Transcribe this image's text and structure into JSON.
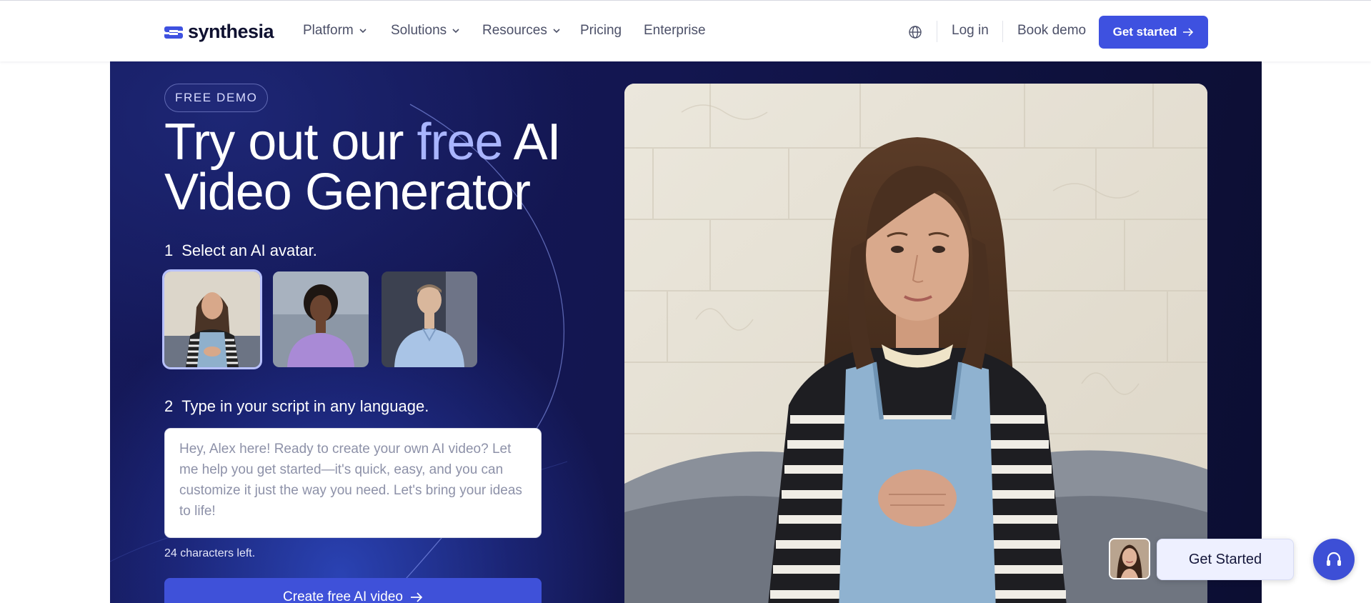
{
  "nav": {
    "logo_text": "synthesia",
    "items": [
      {
        "label": "Platform",
        "has_dropdown": true
      },
      {
        "label": "Solutions",
        "has_dropdown": true
      },
      {
        "label": "Resources",
        "has_dropdown": true
      },
      {
        "label": "Pricing",
        "has_dropdown": false
      },
      {
        "label": "Enterprise",
        "has_dropdown": false
      }
    ],
    "language_icon": "globe-icon",
    "login_label": "Log in",
    "book_demo_label": "Book demo",
    "get_started_label": "Get started"
  },
  "hero": {
    "badge": "FREE DEMO",
    "headline_part1": "Try out our ",
    "headline_accent": "free",
    "headline_part2": " AI",
    "headline_line2": "Video Generator",
    "step1_number": "1",
    "step1_label": "Select an AI avatar.",
    "step2_number": "2",
    "step2_label": "Type in your script in any language.",
    "script_placeholder": "Hey, Alex here! Ready to create your own AI video? Let me help you get started—it's quick, easy, and you can customize it just the way you need. Let's bring your ideas to life!",
    "chars_left": "24 characters left.",
    "create_button": "Create free AI video",
    "avatars_selected_index": 0
  },
  "widgets": {
    "get_started_pill": "Get Started",
    "support_icon": "headset-icon"
  },
  "colors": {
    "brand_blue": "#3e51e0",
    "accent_text": "#a9b5ff",
    "hero_bg": "#131650"
  }
}
